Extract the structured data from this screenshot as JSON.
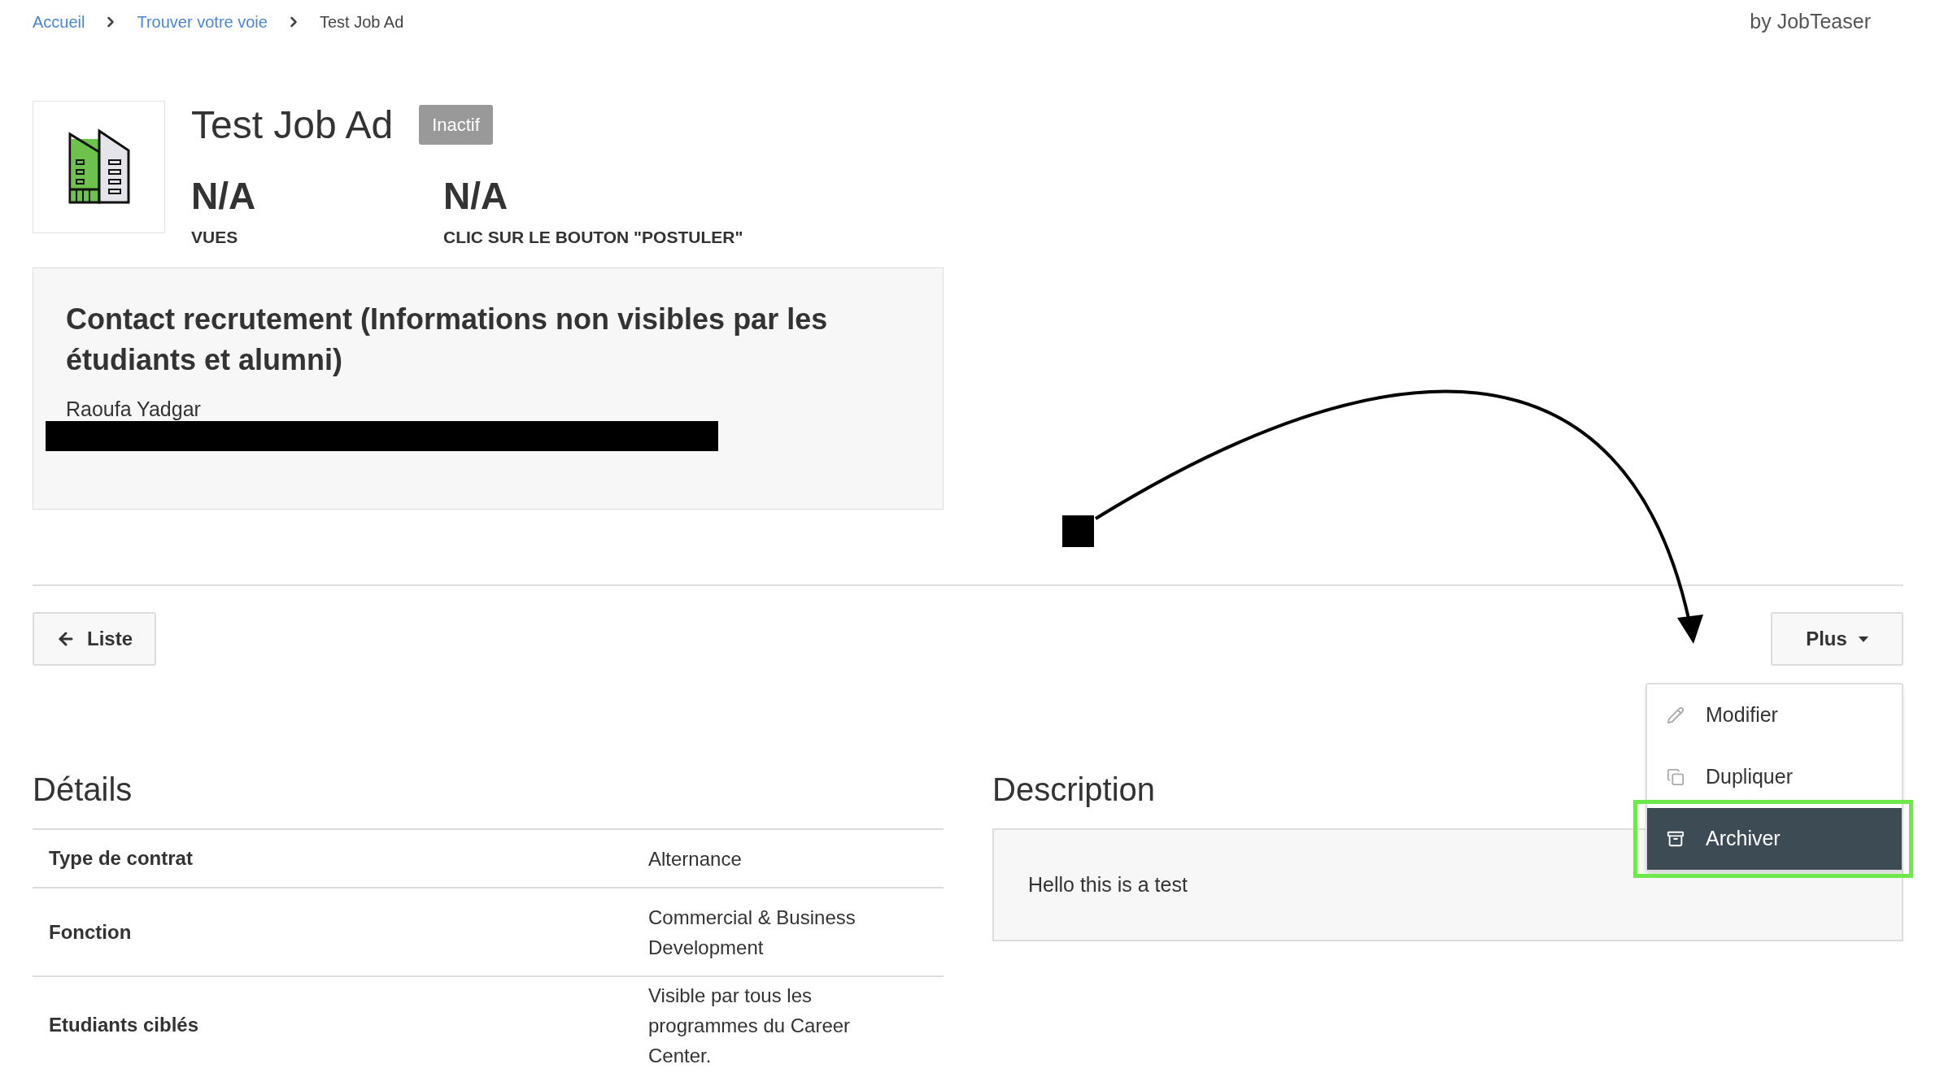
{
  "breadcrumb": [
    {
      "label": "Accueil",
      "kind": "link"
    },
    {
      "label": "Trouver votre voie",
      "kind": "link"
    },
    {
      "label": "Test Job Ad",
      "kind": "current"
    }
  ],
  "brand": "by JobTeaser",
  "job": {
    "title": "Test Job Ad",
    "status": "Inactif",
    "stats": [
      {
        "value": "N/A",
        "label": "VUES"
      },
      {
        "value": "N/A",
        "label": "CLIC SUR LE BOUTON \"POSTULER\""
      }
    ]
  },
  "contact": {
    "heading": "Contact recrutement (Informations non visibles par les étudiants et alumni)",
    "name": "Raoufa Yadgar"
  },
  "back_button": "Liste",
  "more_button": "Plus",
  "menu": [
    {
      "label": "Modifier",
      "kind": "pencil",
      "selected": false
    },
    {
      "label": "Dupliquer",
      "kind": "copy",
      "selected": false
    },
    {
      "label": "Archiver",
      "kind": "archive",
      "selected": true
    }
  ],
  "details": {
    "heading": "Détails",
    "rows": [
      {
        "label": "Type de contrat",
        "value": "Alternance"
      },
      {
        "label": "Fonction",
        "value": "Commercial & Business Development"
      },
      {
        "label": "Etudiants ciblés",
        "value": "Visible par tous les programmes du Career Center."
      }
    ]
  },
  "description": {
    "heading": "Description",
    "text": "Hello this is a test"
  }
}
